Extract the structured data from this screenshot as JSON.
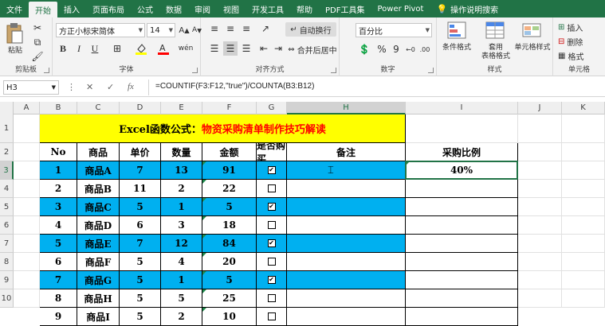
{
  "tabs": [
    "文件",
    "开始",
    "插入",
    "页面布局",
    "公式",
    "数据",
    "审阅",
    "视图",
    "开发工具",
    "帮助",
    "PDF工具集",
    "Power Pivot",
    "操作说明搜索"
  ],
  "ribbon": {
    "paste": "粘贴",
    "clipboard": "剪贴板",
    "font_name": "方正小标宋简体",
    "font_size": "14",
    "bold": "B",
    "italic": "I",
    "underline": "U",
    "font_group": "字体",
    "wrap": "自动换行",
    "merge": "合并后居中",
    "align_group": "对齐方式",
    "number_format": "百分比",
    "percent": "%",
    "comma": "9",
    "number_group": "数字",
    "cond_format": "条件格式",
    "table_format_1": "套用",
    "table_format_2": "表格格式",
    "cell_style": "单元格样式",
    "style_group": "样式",
    "insert": "插入",
    "delete": "删除",
    "format": "格式",
    "cells_group": "单元格"
  },
  "formula_bar": {
    "name_box": "H3",
    "cancel": "✕",
    "enter": "✓",
    "fx": "fx",
    "formula": "=COUNTIF(F3:F12,\"true\")/COUNTA(B3:B12)"
  },
  "columns": [
    "A",
    "B",
    "C",
    "D",
    "E",
    "F",
    "G",
    "H",
    "I",
    "J",
    "K"
  ],
  "rows": [
    "1",
    "2",
    "3",
    "4",
    "5",
    "6",
    "7",
    "8",
    "9",
    "10"
  ],
  "sheet": {
    "title_black": "Excel函数公式：",
    "title_red": "物资采购清单制作技巧解读",
    "headers": [
      "No",
      "商品",
      "单价",
      "数量",
      "金额",
      "是否购买",
      "备注",
      "采购比例"
    ],
    "ratio": "40%",
    "data": [
      {
        "no": "1",
        "item": "商品A",
        "price": "7",
        "qty": "13",
        "amount": "91",
        "buy": true
      },
      {
        "no": "2",
        "item": "商品B",
        "price": "11",
        "qty": "2",
        "amount": "22",
        "buy": false
      },
      {
        "no": "3",
        "item": "商品C",
        "price": "5",
        "qty": "1",
        "amount": "5",
        "buy": true
      },
      {
        "no": "4",
        "item": "商品D",
        "price": "6",
        "qty": "3",
        "amount": "18",
        "buy": false
      },
      {
        "no": "5",
        "item": "商品E",
        "price": "7",
        "qty": "12",
        "amount": "84",
        "buy": true
      },
      {
        "no": "6",
        "item": "商品F",
        "price": "5",
        "qty": "4",
        "amount": "20",
        "buy": false
      },
      {
        "no": "7",
        "item": "商品G",
        "price": "5",
        "qty": "1",
        "amount": "5",
        "buy": true
      },
      {
        "no": "8",
        "item": "商品H",
        "price": "5",
        "qty": "5",
        "amount": "25",
        "buy": false
      },
      {
        "no": "9",
        "item": "商品I",
        "price": "5",
        "qty": "2",
        "amount": "10",
        "buy": false
      }
    ]
  },
  "colors": {
    "excel_green": "#217346",
    "row_highlight": "#00b0f0",
    "title_fill": "#ffff00",
    "title_red": "#ff0000"
  }
}
